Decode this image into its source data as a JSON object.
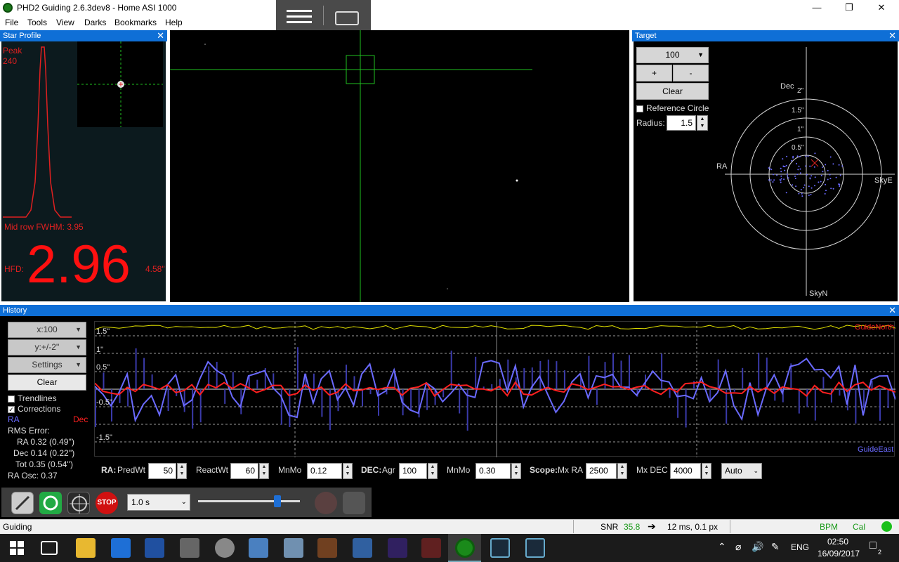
{
  "window": {
    "title": "PHD2 Guiding 2.6.3dev8 - Home ASI 1000"
  },
  "menu": {
    "items": [
      "File",
      "Tools",
      "View",
      "Darks",
      "Bookmarks",
      "Help"
    ]
  },
  "star_profile": {
    "title": "Star Profile",
    "peak_label": "Peak",
    "peak_value": "240",
    "fwhm": "Mid row FWHM: 3.95",
    "hfd_label": "HFD:",
    "hfd_value": "2.96",
    "hfd_arcsec": "4.58\""
  },
  "target": {
    "title": "Target",
    "scale_select": "100",
    "plus": "+",
    "minus": "-",
    "clear": "Clear",
    "reference_circle": "Reference Circle",
    "radius_label": "Radius:",
    "radius_value": "1.5",
    "dec_label": "Dec",
    "ra_label": "RA",
    "sky_e": "SkyE",
    "sky_n": "SkyN",
    "rings": [
      "2\"",
      "1.5\"",
      "1\"",
      "0.5\""
    ]
  },
  "history": {
    "title": "History",
    "x_select": "x:100",
    "y_select": "y:+/-2''",
    "settings": "Settings",
    "clear": "Clear",
    "trendlines": "Trendlines",
    "corrections": "Corrections",
    "ra_label": "RA",
    "dec_label": "Dec",
    "rms_error": "RMS Error:",
    "rms_ra": "RA  0.32 (0.49'')",
    "rms_dec": "Dec  0.14 (0.22'')",
    "rms_tot": "Tot  0.35 (0.54'')",
    "ra_osc": "RA Osc: 0.37",
    "guide_north": "GuideNorth",
    "guide_east": "GuideEast",
    "y_ticks": [
      "1.5\"",
      "1\"",
      "0.5\"",
      "-0.5\"",
      "-1.5\""
    ],
    "params": {
      "ra": "RA:",
      "predwt": "PredWt",
      "predwt_val": "50",
      "reactwt": "ReactWt",
      "reactwt_val": "60",
      "mnmo": "MnMo",
      "mnmo_val": "0.12",
      "dec": "DEC:",
      "agr": "Agr",
      "agr_val": "100",
      "dec_mnmo": "MnMo",
      "dec_mnmo_val": "0.30",
      "scope": "Scope:",
      "mxra": "Mx RA",
      "mxra_val": "2500",
      "mxdec": "Mx DEC",
      "mxdec_val": "4000",
      "mode": "Auto"
    },
    "colors": {
      "ra": "#6a6aff",
      "dec": "#ff2020",
      "snr": "#e0e000"
    }
  },
  "toolbar": {
    "exposure": "1.0 s",
    "stop": "STOP",
    "gamma_level": 0.78
  },
  "status": {
    "state": "Guiding",
    "snr_label": "SNR",
    "snr_value": "35.8",
    "pulse": "12 ms, 0.1 px",
    "bpm": "BPM",
    "cal": "Cal"
  },
  "taskbar": {
    "lang": "ENG",
    "time": "02:50",
    "date": "16/09/2017",
    "notif": "2"
  }
}
